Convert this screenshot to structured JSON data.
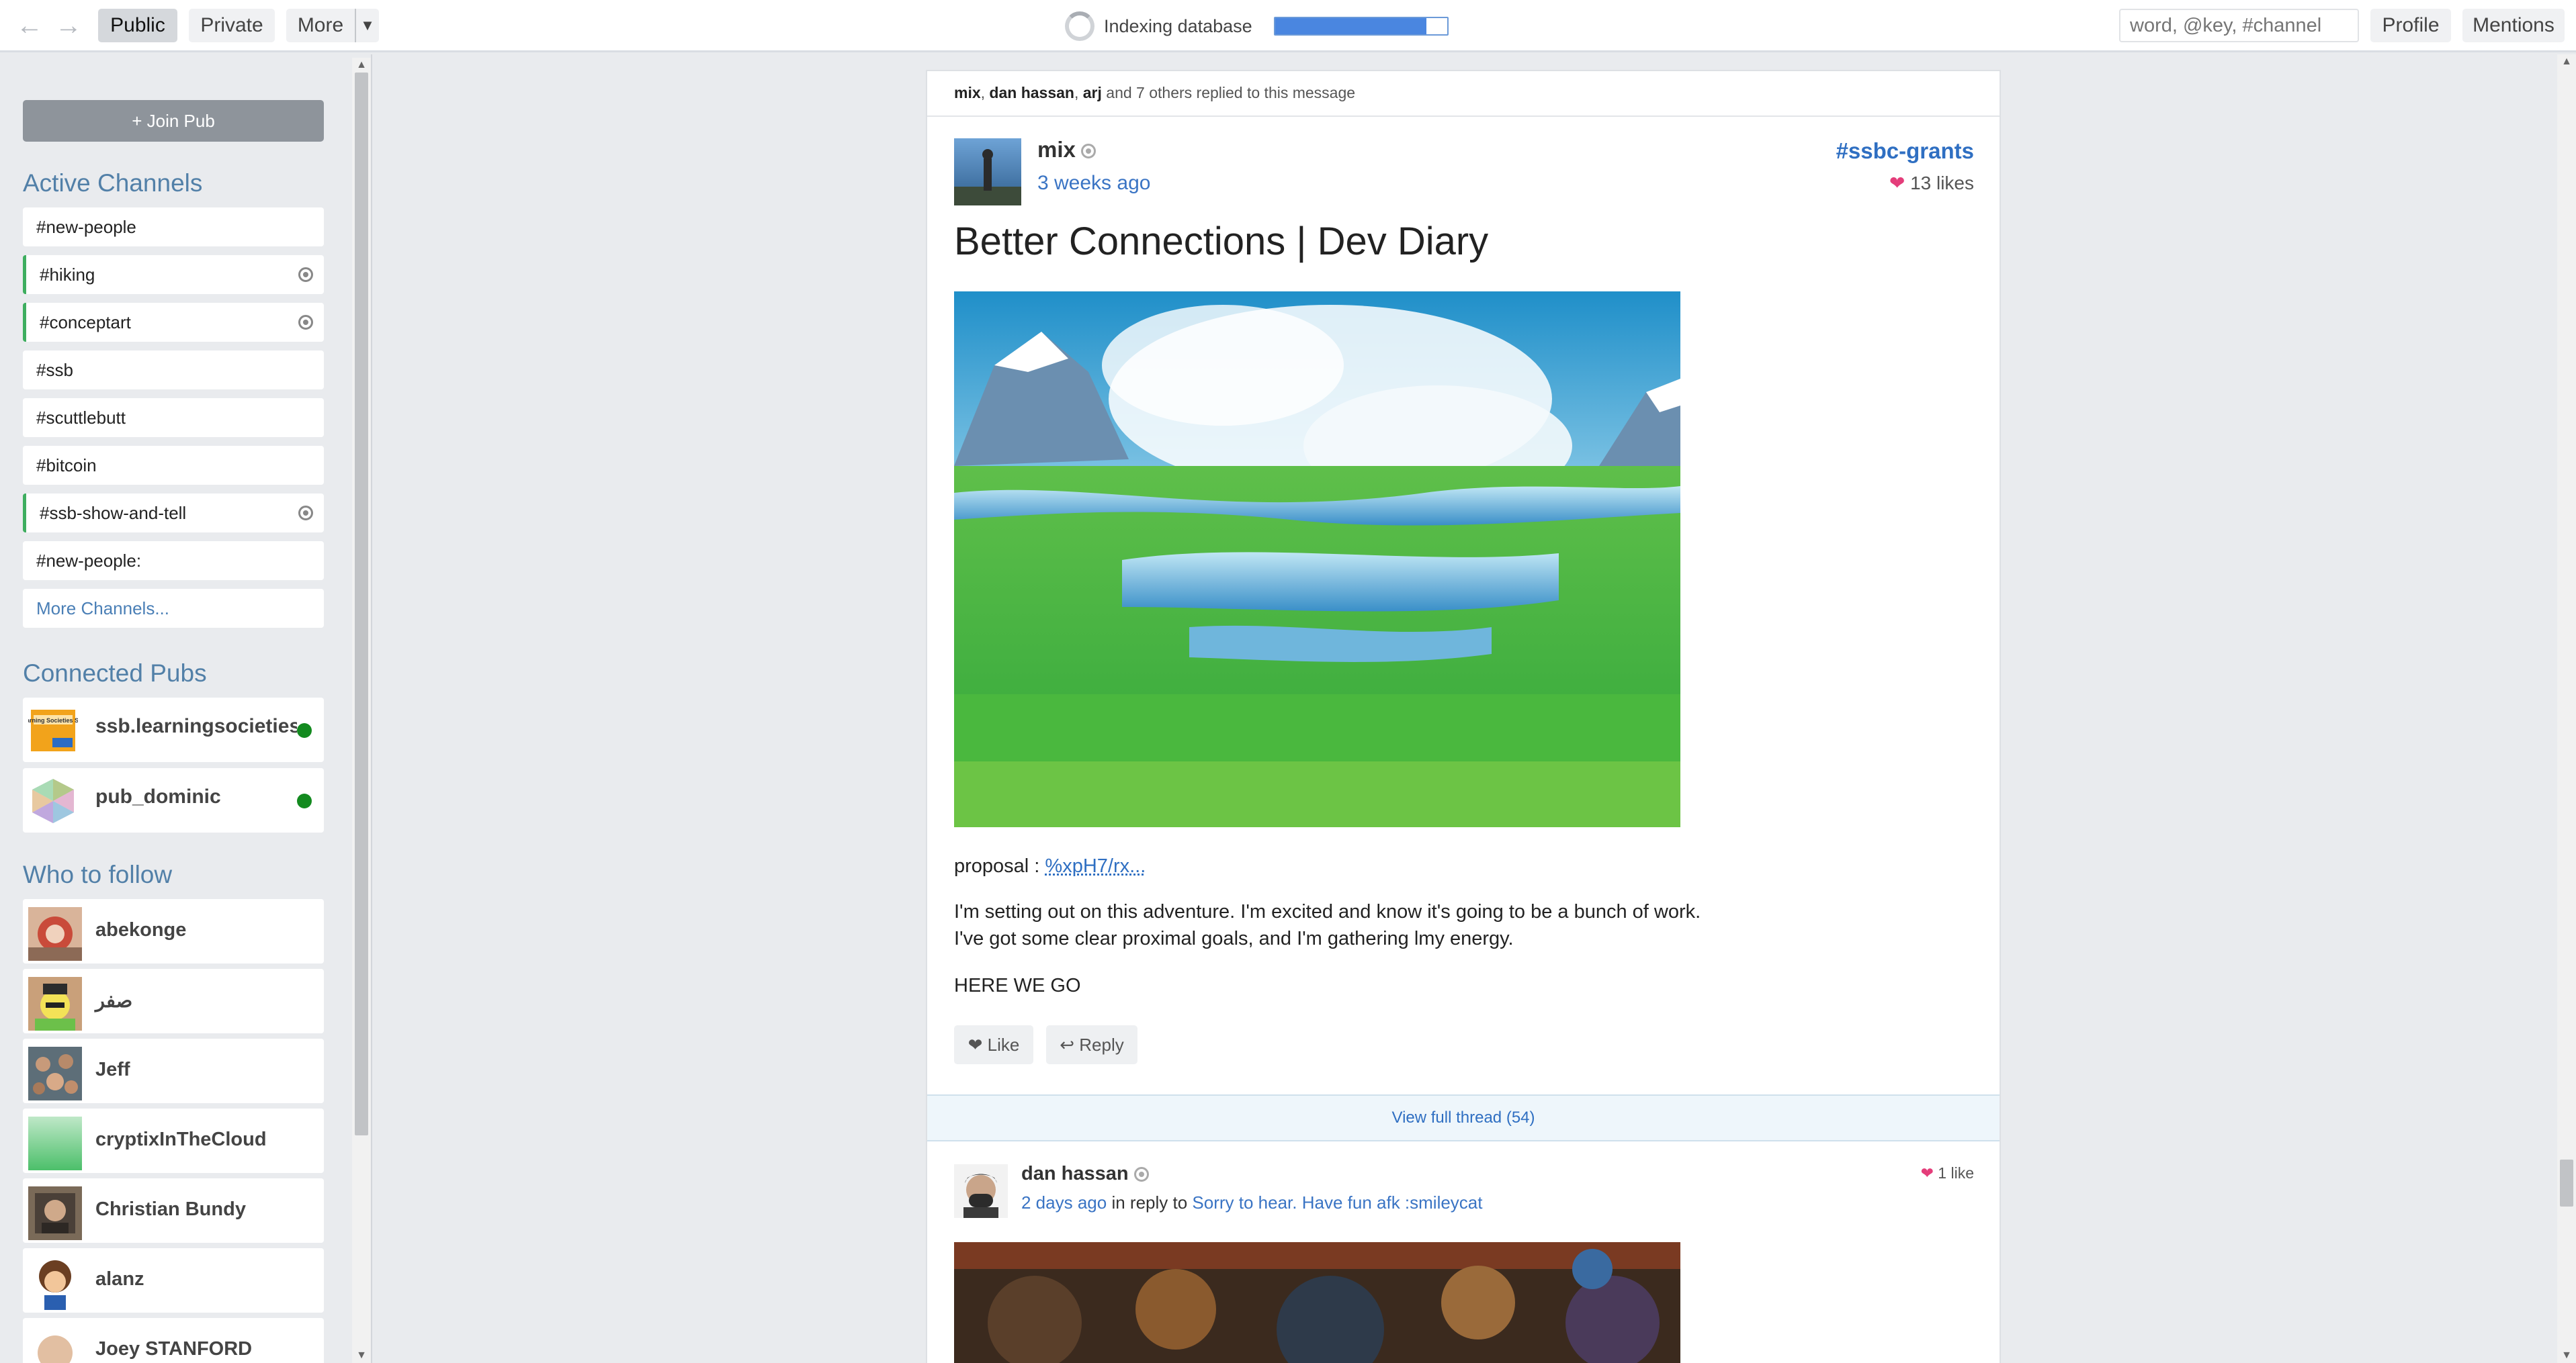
{
  "toolbar": {
    "back_icon": "left-arrow-icon",
    "forward_icon": "right-arrow-icon",
    "tabs": [
      "Public",
      "Private",
      "More"
    ],
    "active_tab": "Public",
    "more_dropdown_icon": "caret-down-icon",
    "indexing_label": "Indexing database",
    "indexing_progress": 0.88,
    "search_placeholder": "word, @key, #channel",
    "profile_label": "Profile",
    "mentions_label": "Mentions"
  },
  "sidebar": {
    "join_pub_label": "+ Join Pub",
    "active_channels_heading": "Active Channels",
    "channels": [
      {
        "name": "#new-people",
        "subscribed": false
      },
      {
        "name": "#hiking",
        "subscribed": true
      },
      {
        "name": "#conceptart",
        "subscribed": true
      },
      {
        "name": "#ssb",
        "subscribed": false
      },
      {
        "name": "#scuttlebutt",
        "subscribed": false
      },
      {
        "name": "#bitcoin",
        "subscribed": false
      },
      {
        "name": "#ssb-show-and-tell",
        "subscribed": true
      },
      {
        "name": "#new-people:",
        "subscribed": false
      }
    ],
    "more_channels_label": "More Channels...",
    "connected_pubs_heading": "Connected Pubs",
    "pubs": [
      {
        "name": "ssb.learningsocieties",
        "status": "online",
        "logo_text": "Learning Societies SSB"
      },
      {
        "name": "pub_dominic",
        "status": "online"
      }
    ],
    "who_to_follow_heading": "Who to follow",
    "follow": [
      "abekonge",
      "صفر",
      "Jeff",
      "cryptixInTheCloud",
      "Christian Bundy",
      "alanz",
      "Joey STANFORD"
    ]
  },
  "thread": {
    "replied_names": [
      "mix",
      "dan hassan",
      "arj"
    ],
    "replied_suffix": "and 7 others replied to this message",
    "author": "mix",
    "timestamp": "3 weeks ago",
    "channel": "#ssbc-grants",
    "likes": "13 likes",
    "title": "Better Connections | Dev Diary",
    "proposal_label": "proposal :",
    "proposal_link": "%xpH7/rx...",
    "body_line1": "I'm setting out on this adventure. I'm excited and know it's going to be a bunch of work.",
    "body_line2": "I've got some clear proximal goals, and I'm gathering lmy energy.",
    "body_line3": "HERE WE GO",
    "like_label": "❤ Like",
    "reply_label": "↩ Reply",
    "view_thread_label": "View full thread (54)"
  },
  "reply": {
    "author": "dan hassan",
    "timestamp": "2 days ago",
    "in_reply_to_label": "in reply to",
    "in_reply_to_link": "Sorry to hear. Have fun afk :smileycat",
    "likes": "1 like"
  },
  "colors": {
    "accent": "#2f6fc2",
    "heart": "#e43d7a",
    "online": "#138a1f",
    "subscribed_border": "#3eae5f",
    "progress": "#4a86e0"
  }
}
